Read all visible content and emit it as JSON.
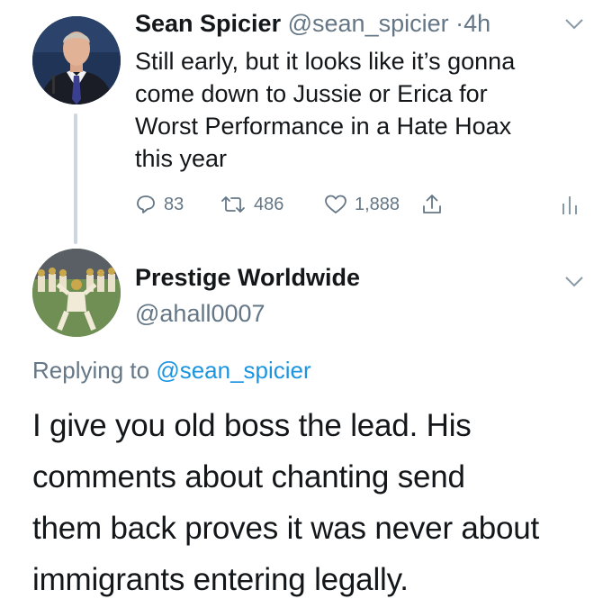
{
  "original_tweet": {
    "author_name": "Sean Spicier",
    "author_handle": "@sean_spicier",
    "separator": "·",
    "time": "4h",
    "text_lines": [
      "Still early, but it looks like it’s gonna",
      "come down to Jussie or Erica for",
      "Worst Performance in a Hate Hoax",
      "this year"
    ],
    "actions": {
      "replies": "83",
      "retweets": "486",
      "likes": "1,888"
    },
    "icons": [
      "reply-icon",
      "retweet-icon",
      "like-icon",
      "share-icon",
      "analytics-icon",
      "chevron-down-icon"
    ]
  },
  "reply_tweet": {
    "author_name": "Prestige Worldwide",
    "author_handle": "@ahall0007",
    "replying_prefix": "Replying to",
    "replying_to": "@sean_spicier",
    "text_lines": [
      "I give you old boss the lead.  His",
      "comments about chanting send",
      "them back proves it was never about",
      "immigrants entering legally."
    ]
  },
  "colors": {
    "text": "#14171a",
    "secondary": "#657786",
    "link": "#1b95e0",
    "thread_line": "#ccd6dd"
  }
}
